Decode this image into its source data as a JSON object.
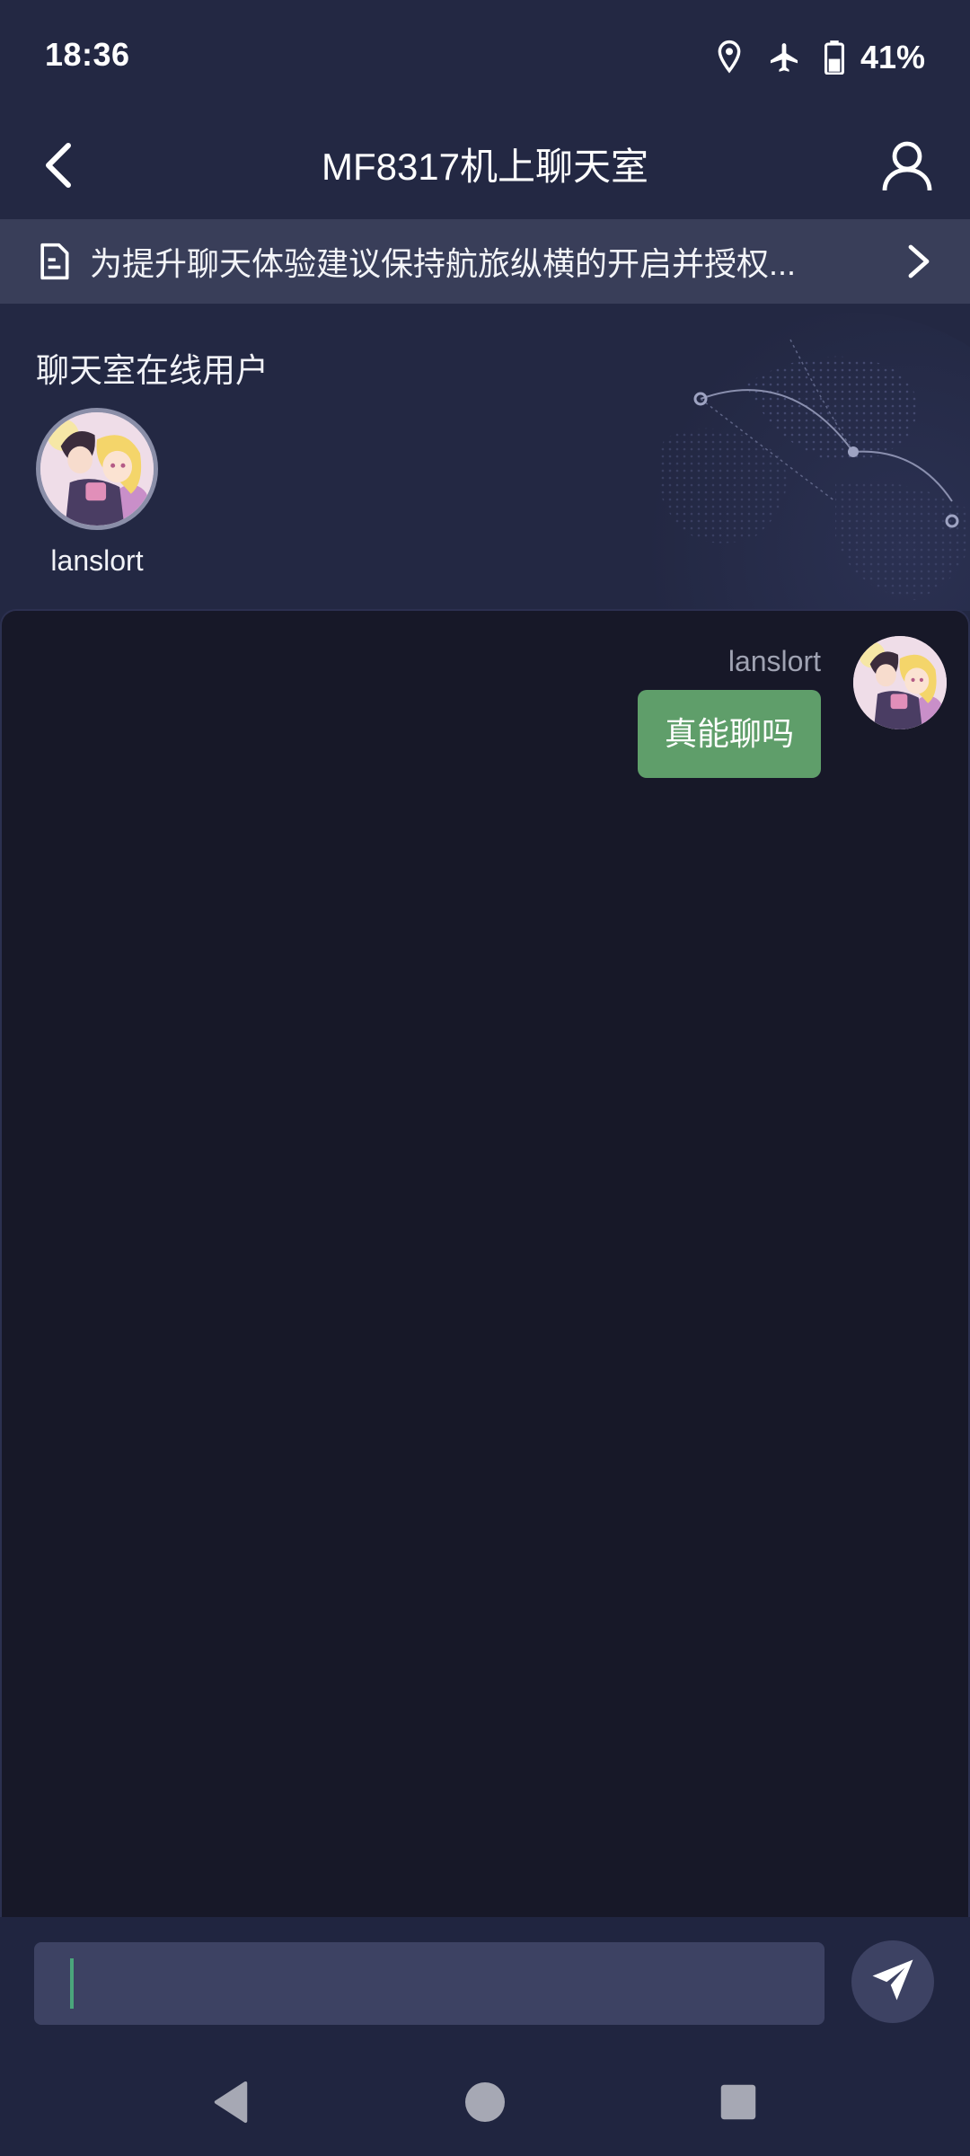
{
  "status_bar": {
    "time": "18:36",
    "battery_percent": "41%",
    "icons": [
      "location-icon",
      "airplane-mode-icon",
      "battery-icon"
    ]
  },
  "header": {
    "title": "MF8317机上聊天室",
    "back_icon": "chevron-left-icon",
    "profile_icon": "user-icon"
  },
  "notice": {
    "text": "为提升聊天体验建议保持航旅纵横的开启并授权...",
    "icon": "document-icon"
  },
  "online": {
    "title": "聊天室在线用户",
    "users": [
      {
        "name": "lanslort"
      }
    ]
  },
  "messages": [
    {
      "sender": "lanslort",
      "text": "真能聊吗",
      "side": "right"
    }
  ],
  "input": {
    "value": "",
    "placeholder": ""
  },
  "colors": {
    "background": "#232843",
    "chat_background": "#171828",
    "bubble": "#5f9e6a",
    "notice_bar": "#393e59",
    "input_field": "#3d4263",
    "caret": "#4aa67b"
  }
}
